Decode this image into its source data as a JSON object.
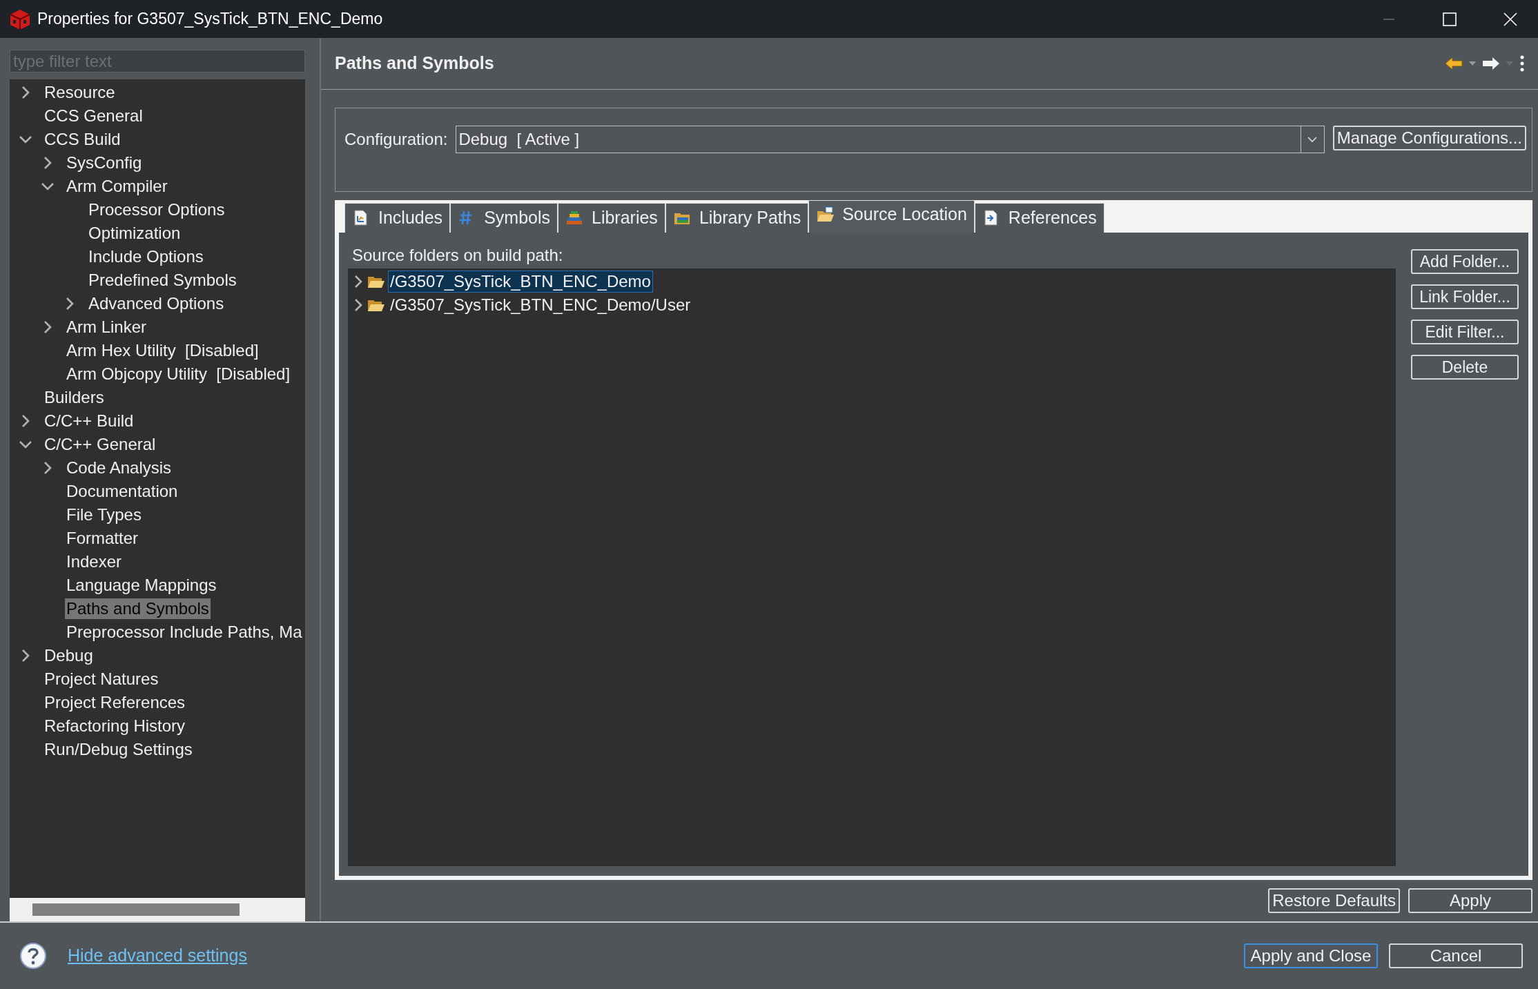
{
  "window": {
    "title": "Properties for G3507_SysTick_BTN_ENC_Demo"
  },
  "filter": {
    "placeholder": "type filter text"
  },
  "tree": [
    {
      "label": "Resource",
      "expandable": true,
      "expanded": false,
      "selected": false
    },
    {
      "label": "CCS General",
      "expandable": false,
      "selected": false
    },
    {
      "label": "CCS Build",
      "expandable": true,
      "expanded": true,
      "selected": false,
      "children": [
        {
          "label": "SysConfig",
          "expandable": true,
          "expanded": false,
          "selected": false
        },
        {
          "label": "Arm Compiler",
          "expandable": true,
          "expanded": true,
          "selected": false,
          "children": [
            {
              "label": "Processor Options",
              "expandable": false,
              "selected": false
            },
            {
              "label": "Optimization",
              "expandable": false,
              "selected": false
            },
            {
              "label": "Include Options",
              "expandable": false,
              "selected": false
            },
            {
              "label": "Predefined Symbols",
              "expandable": false,
              "selected": false
            },
            {
              "label": "Advanced Options",
              "expandable": true,
              "expanded": false,
              "selected": false
            }
          ]
        },
        {
          "label": "Arm Linker",
          "expandable": true,
          "expanded": false,
          "selected": false
        },
        {
          "label": "Arm Hex Utility  [Disabled]",
          "expandable": false,
          "selected": false
        },
        {
          "label": "Arm Objcopy Utility  [Disabled]",
          "expandable": false,
          "selected": false
        }
      ]
    },
    {
      "label": "Builders",
      "expandable": false,
      "selected": false
    },
    {
      "label": "C/C++ Build",
      "expandable": true,
      "expanded": false,
      "selected": false
    },
    {
      "label": "C/C++ General",
      "expandable": true,
      "expanded": true,
      "selected": false,
      "children": [
        {
          "label": "Code Analysis",
          "expandable": true,
          "expanded": false,
          "selected": false
        },
        {
          "label": "Documentation",
          "expandable": false,
          "selected": false
        },
        {
          "label": "File Types",
          "expandable": false,
          "selected": false
        },
        {
          "label": "Formatter",
          "expandable": false,
          "selected": false
        },
        {
          "label": "Indexer",
          "expandable": false,
          "selected": false
        },
        {
          "label": "Language Mappings",
          "expandable": false,
          "selected": false
        },
        {
          "label": "Paths and Symbols",
          "expandable": false,
          "selected": true
        },
        {
          "label": "Preprocessor Include Paths, Ma",
          "expandable": false,
          "selected": false
        }
      ]
    },
    {
      "label": "Debug",
      "expandable": true,
      "expanded": false,
      "selected": false
    },
    {
      "label": "Project Natures",
      "expandable": false,
      "selected": false
    },
    {
      "label": "Project References",
      "expandable": false,
      "selected": false
    },
    {
      "label": "Refactoring History",
      "expandable": false,
      "selected": false
    },
    {
      "label": "Run/Debug Settings",
      "expandable": false,
      "selected": false
    }
  ],
  "page": {
    "title": "Paths and Symbols"
  },
  "configuration": {
    "label": "Configuration:",
    "value": "Debug  [ Active ]",
    "manage_button": "Manage Configurations..."
  },
  "tabs": [
    {
      "label": "Includes",
      "kind": "includes",
      "selected": false
    },
    {
      "label": "Symbols",
      "kind": "symbols",
      "selected": false
    },
    {
      "label": "Libraries",
      "kind": "libraries",
      "selected": false
    },
    {
      "label": "Library Paths",
      "kind": "library-paths",
      "selected": false
    },
    {
      "label": "Source Location",
      "kind": "source-location",
      "selected": true
    },
    {
      "label": "References",
      "kind": "references",
      "selected": false
    }
  ],
  "source": {
    "label": "Source folders on build path:",
    "folders": [
      {
        "path": "/G3507_SysTick_BTN_ENC_Demo",
        "expanded": false,
        "selected": true
      },
      {
        "path": "/G3507_SysTick_BTN_ENC_Demo/User",
        "expanded": false,
        "selected": false
      }
    ]
  },
  "side_buttons": [
    "Add Folder...",
    "Link Folder...",
    "Edit Filter...",
    "Delete"
  ],
  "page_buttons": [
    "Restore Defaults",
    "Apply"
  ],
  "footer": {
    "link": "Hide advanced settings",
    "buttons": [
      {
        "label": "Apply and Close",
        "default": true
      },
      {
        "label": "Cancel",
        "default": false
      }
    ]
  }
}
